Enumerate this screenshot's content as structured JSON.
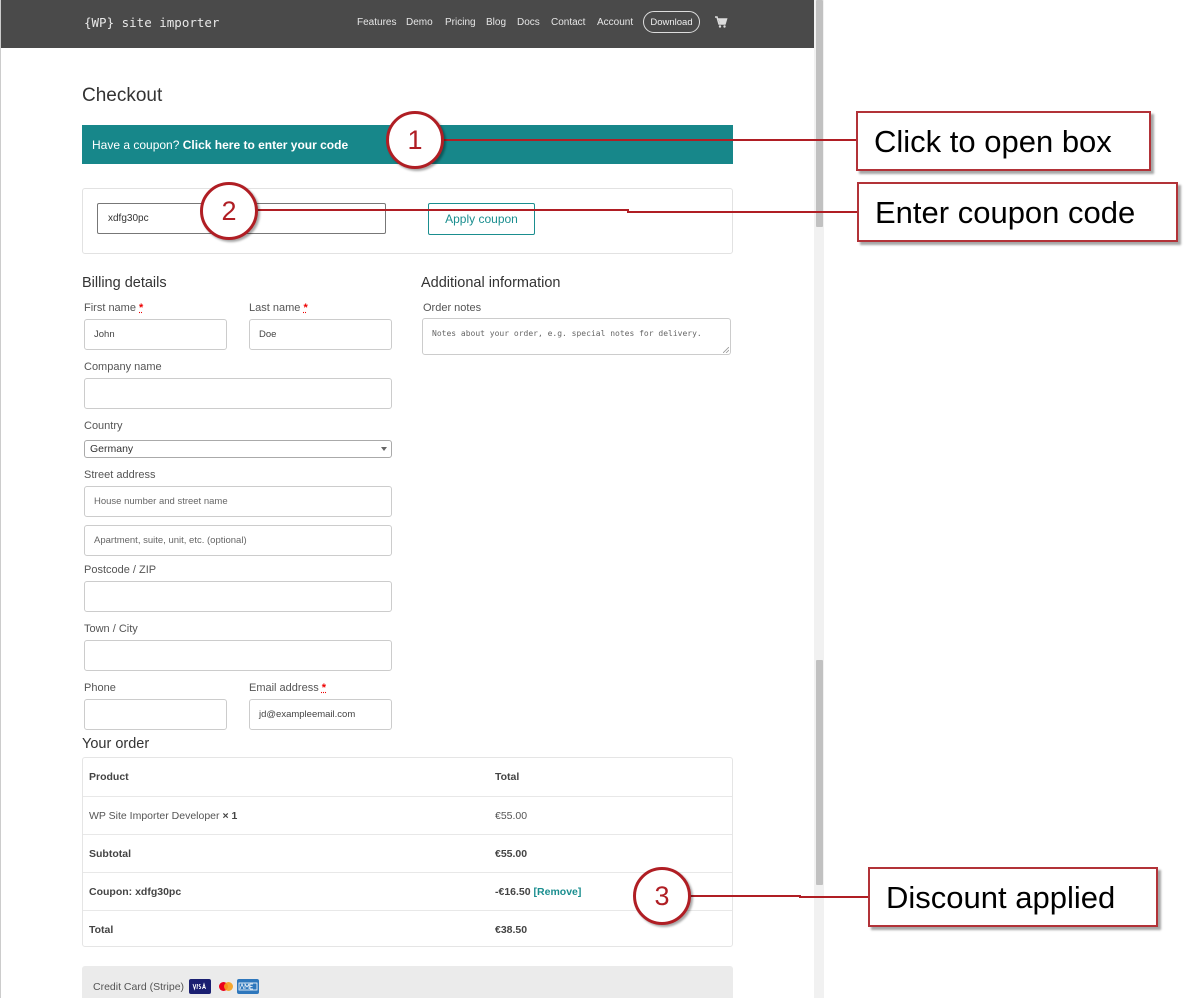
{
  "nav": {
    "brand": "{WP} site importer",
    "links": [
      "Features",
      "Demo",
      "Pricing",
      "Blog",
      "Docs",
      "Contact",
      "Account"
    ],
    "download": "Download"
  },
  "page_title": "Checkout",
  "coupon_bar": {
    "prefix": "Have a coupon?",
    "link": "Click here to enter your code"
  },
  "coupon_form": {
    "code": "xdfg30pc",
    "apply": "Apply coupon"
  },
  "billing": {
    "heading": "Billing details",
    "first_name": {
      "label": "First name",
      "value": "John"
    },
    "last_name": {
      "label": "Last name",
      "value": "Doe"
    },
    "company": {
      "label": "Company name",
      "value": ""
    },
    "country": {
      "label": "Country",
      "value": "Germany"
    },
    "street": {
      "label": "Street address",
      "placeholder1": "House number and street name",
      "placeholder2": "Apartment, suite, unit, etc. (optional)"
    },
    "postcode": {
      "label": "Postcode / ZIP",
      "value": ""
    },
    "town": {
      "label": "Town / City",
      "value": ""
    },
    "phone": {
      "label": "Phone",
      "value": ""
    },
    "email": {
      "label": "Email address",
      "value": "jd@exampleemail.com"
    },
    "required_mark": "*"
  },
  "additional": {
    "heading": "Additional information",
    "notes_label": "Order notes",
    "notes_placeholder": "Notes about your order, e.g. special notes for delivery."
  },
  "order": {
    "heading": "Your order",
    "col_product": "Product",
    "col_total": "Total",
    "item_name": "WP Site Importer Developer",
    "item_qty": "× 1",
    "item_total": "€55.00",
    "subtotal_label": "Subtotal",
    "subtotal": "€55.00",
    "coupon_label": "Coupon: xdfg30pc",
    "coupon_amount": "-€16.50",
    "coupon_remove": "[Remove]",
    "total_label": "Total",
    "total": "€38.50"
  },
  "payment": {
    "method": "Credit Card (Stripe)"
  },
  "annotations": {
    "one": {
      "num": "1",
      "text": "Click to open box"
    },
    "two": {
      "num": "2",
      "text": "Enter coupon code"
    },
    "three": {
      "num": "3",
      "text": "Discount applied"
    }
  },
  "colors": {
    "accent": "#17878a",
    "annotation": "#b01e24",
    "nav": "#4a4a4a"
  }
}
